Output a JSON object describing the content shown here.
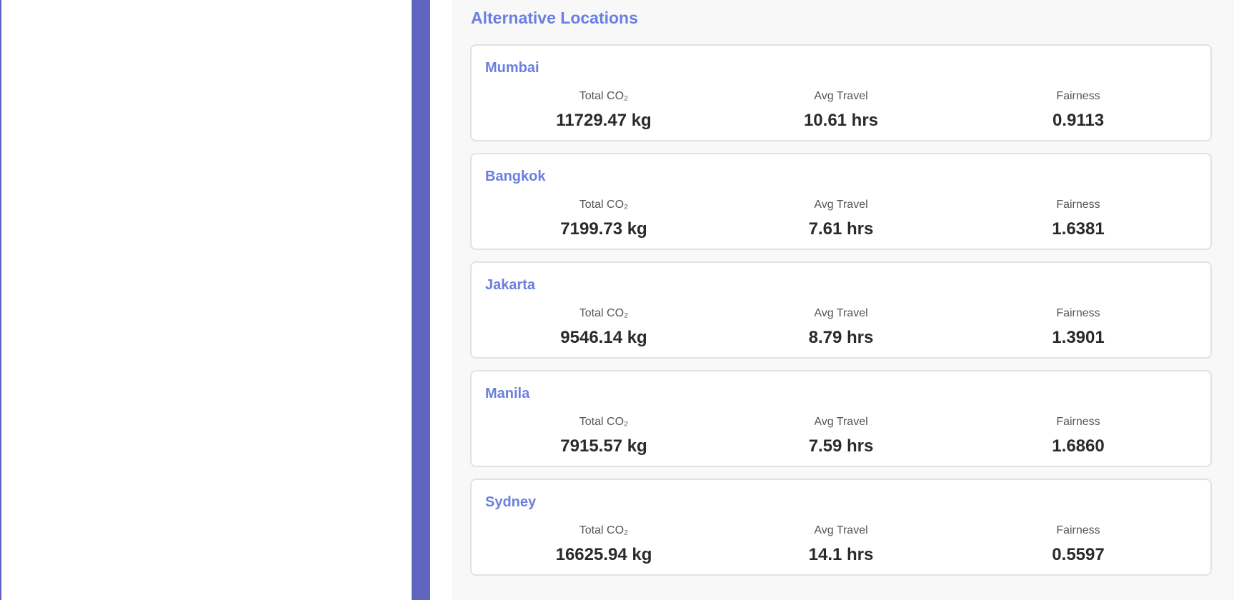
{
  "panel": {
    "title": "Alternative Locations"
  },
  "labels": {
    "co2": "Total CO₂",
    "travel": "Avg Travel",
    "fairness": "Fairness"
  },
  "locations": [
    {
      "name": "Mumbai",
      "co2": "11729.47 kg",
      "travel": "10.61 hrs",
      "fairness": "0.9113"
    },
    {
      "name": "Bangkok",
      "co2": "7199.73 kg",
      "travel": "7.61 hrs",
      "fairness": "1.6381"
    },
    {
      "name": "Jakarta",
      "co2": "9546.14 kg",
      "travel": "8.79 hrs",
      "fairness": "1.3901"
    },
    {
      "name": "Manila",
      "co2": "7915.57 kg",
      "travel": "7.59 hrs",
      "fairness": "1.6860"
    },
    {
      "name": "Sydney",
      "co2": "16625.94 kg",
      "travel": "14.1 hrs",
      "fairness": "0.5597"
    }
  ],
  "colors": {
    "accent": "#6065c0",
    "heading": "#6a7fe0",
    "panel_bg": "#f8f8f8"
  }
}
